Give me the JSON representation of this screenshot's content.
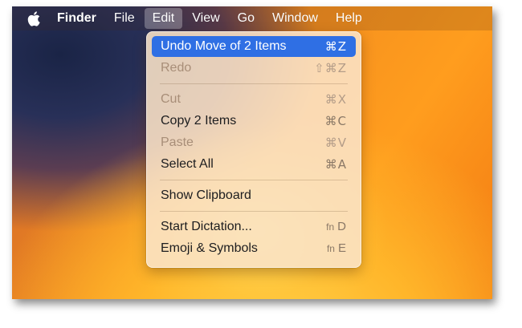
{
  "menubar": {
    "apple_icon": "apple-logo-icon",
    "items": [
      {
        "label": "Finder"
      },
      {
        "label": "File"
      },
      {
        "label": "Edit"
      },
      {
        "label": "View"
      },
      {
        "label": "Go"
      },
      {
        "label": "Window"
      },
      {
        "label": "Help"
      }
    ],
    "active_item": "Edit"
  },
  "edit_menu": {
    "items": [
      {
        "label": "Undo Move of 2 Items",
        "shortcut": "⌘Z",
        "state": "selected"
      },
      {
        "label": "Redo",
        "shortcut": "⇧⌘Z",
        "state": "disabled"
      },
      {
        "label": "Cut",
        "shortcut": "⌘X",
        "state": "disabled"
      },
      {
        "label": "Copy 2 Items",
        "shortcut": "⌘C",
        "state": "enabled"
      },
      {
        "label": "Paste",
        "shortcut": "⌘V",
        "state": "disabled"
      },
      {
        "label": "Select All",
        "shortcut": "⌘A",
        "state": "enabled"
      },
      {
        "label": "Show Clipboard",
        "shortcut": "",
        "state": "enabled"
      },
      {
        "label": "Start Dictation...",
        "shortcut_fn": "fn",
        "shortcut": "D",
        "state": "enabled"
      },
      {
        "label": "Emoji & Symbols",
        "shortcut_fn": "fn",
        "shortcut": "E",
        "state": "enabled"
      }
    ]
  },
  "colors": {
    "selection": "#2f6fe4",
    "menu_background": "#fae4c8",
    "wallpaper_orange": "#ff9d1e",
    "wallpaper_dark": "#1a2446"
  }
}
